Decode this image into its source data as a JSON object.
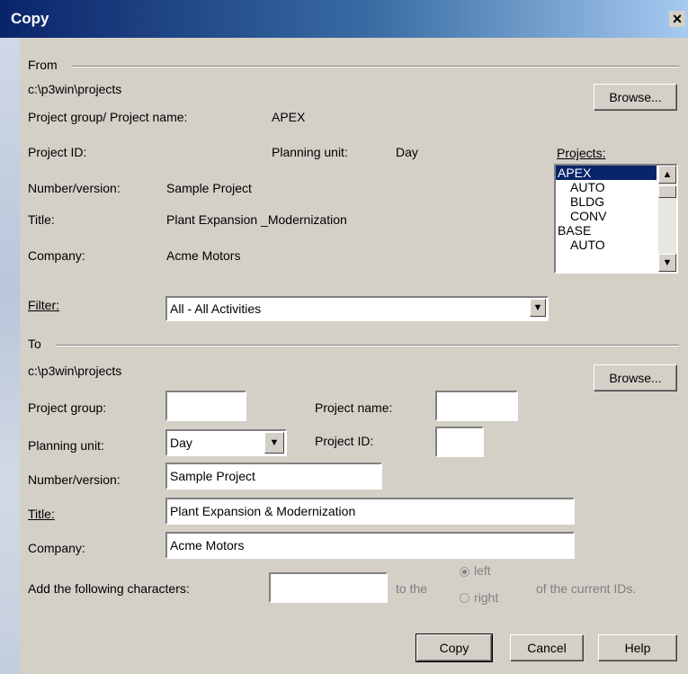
{
  "window": {
    "title": "Copy",
    "close_glyph": "×"
  },
  "from": {
    "group_label": "From",
    "path": "c:\\p3win\\projects",
    "browse_label": "Browse...",
    "project_group_label": "Project group/ Project name:",
    "project_group_value": "APEX",
    "project_id_label": "Project ID:",
    "planning_unit_label": "Planning unit:",
    "planning_unit_value": "Day",
    "number_version_label": "Number/version:",
    "number_version_value": "Sample Project",
    "title_label": "Title:",
    "title_value": "Plant Expansion _Modernization",
    "company_label": "Company:",
    "company_value": "Acme Motors",
    "projects_label": "Projects:",
    "projects": [
      "APEX",
      "AUTO",
      "BLDG",
      "CONV",
      "BASE",
      "AUTO"
    ],
    "selected_project": "APEX",
    "filter_label": "Filter:",
    "filter_value": "All - All Activities"
  },
  "to": {
    "group_label": "To",
    "path": "c:\\p3win\\projects",
    "browse_label": "Browse...",
    "project_group_label": "Project group:",
    "project_group_value": "",
    "project_name_label": "Project name:",
    "project_name_value": "",
    "planning_unit_label": "Planning unit:",
    "planning_unit_value": "Day",
    "project_id_label": "Project ID:",
    "project_id_value": "",
    "number_version_label": "Number/version:",
    "number_version_value": "Sample Project",
    "title_label": "Title:",
    "title_value": "Plant Expansion & Modernization",
    "company_label": "Company:",
    "company_value": "Acme Motors",
    "add_chars_label": "Add the following characters:",
    "add_chars_value": "",
    "to_the_label": "to the",
    "left_label": "left",
    "right_label": "right",
    "left_selected": true,
    "current_ids_label": "of the current IDs."
  },
  "buttons": {
    "copy": "Copy",
    "cancel": "Cancel",
    "help": "Help"
  }
}
